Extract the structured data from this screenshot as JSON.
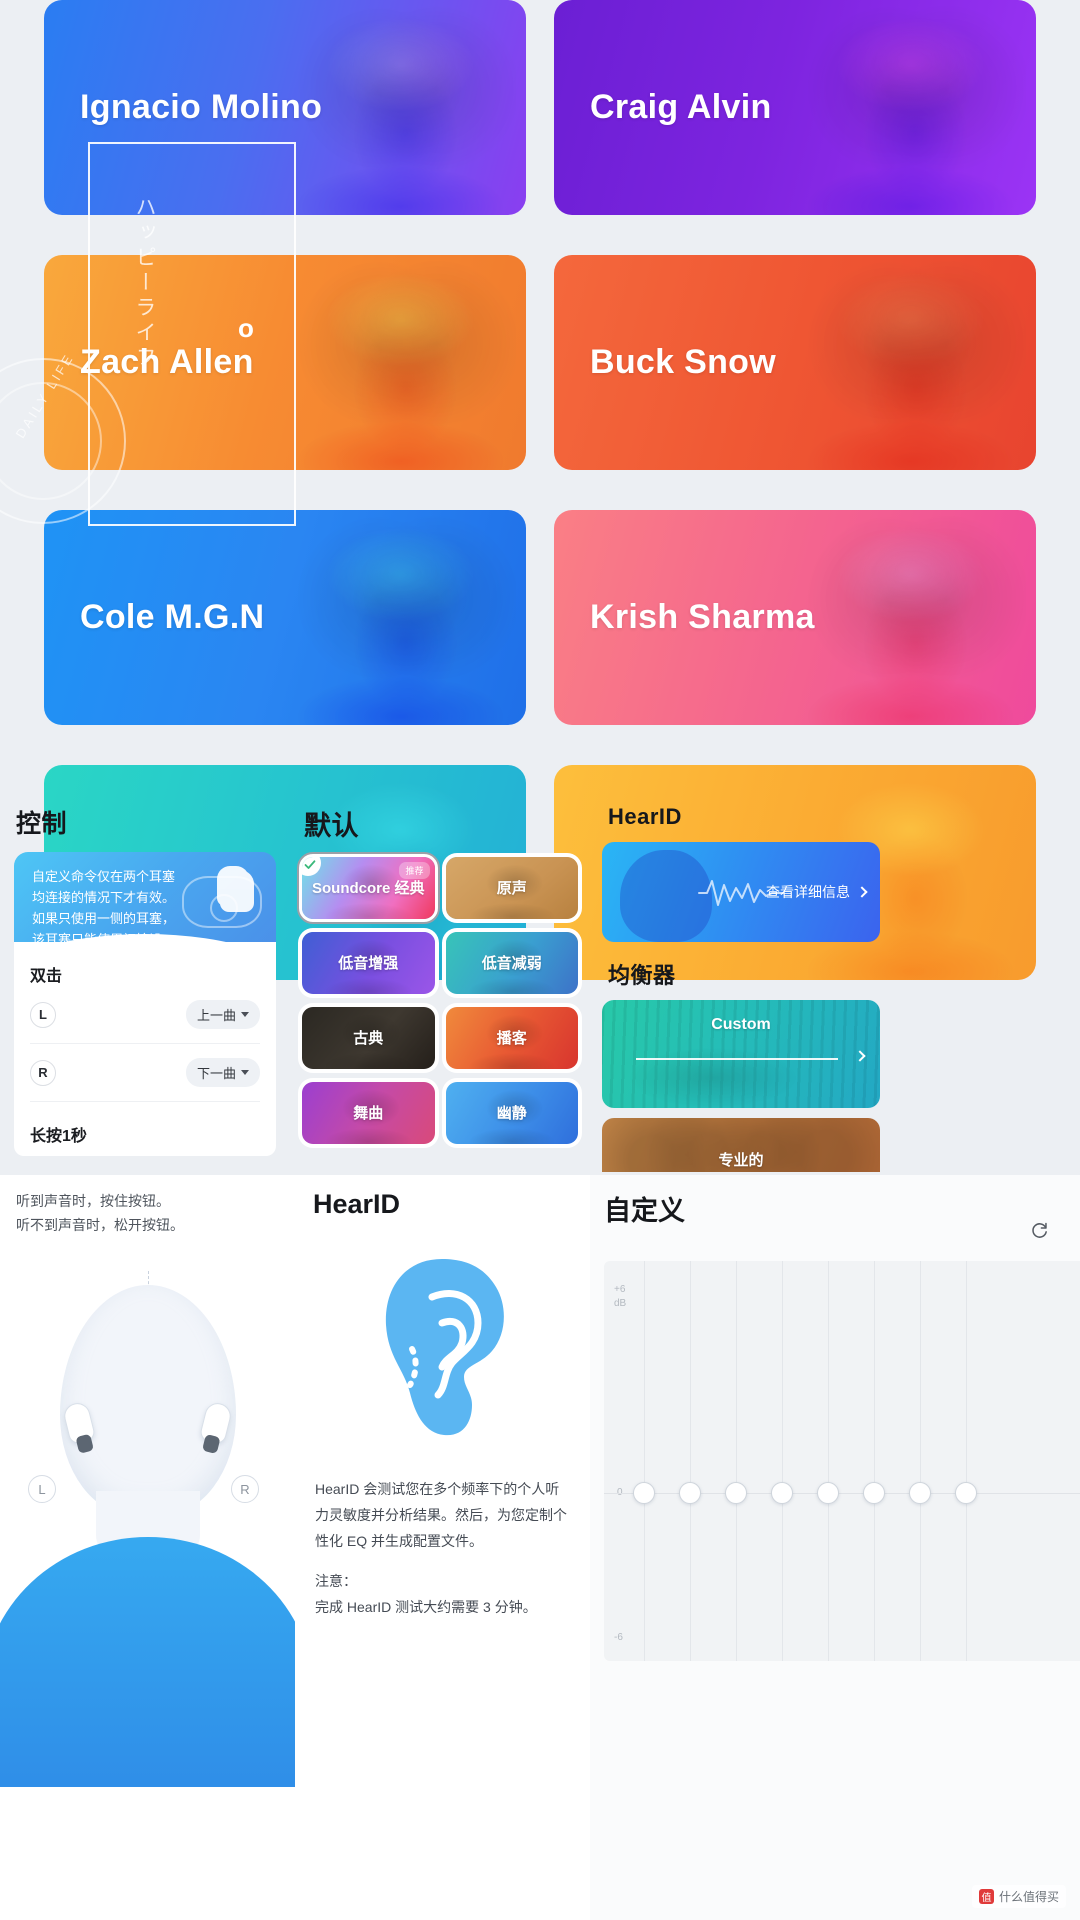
{
  "artists": {
    "rows": [
      [
        {
          "name": "Ignacio Molino",
          "theme": "c-ignacio"
        },
        {
          "name": "Craig Alvin",
          "theme": "c-craig"
        }
      ],
      [
        {
          "name": "Zach Allen",
          "theme": "c-zach"
        },
        {
          "name": "Buck Snow",
          "theme": "c-buck"
        }
      ],
      [
        {
          "name": "Cole M.G.N",
          "theme": "c-cole"
        },
        {
          "name": "Krish Sharma",
          "theme": "c-krish"
        }
      ],
      [
        {
          "name": "",
          "theme": "c-teal"
        },
        {
          "name": "",
          "theme": "c-amber"
        }
      ]
    ],
    "decor": {
      "japanese": "ハッピーライフ",
      "life_text": "DAILY LIFE",
      "degree_mark": "o"
    }
  },
  "control": {
    "title": "控制",
    "banner_text": "自定义命令仅在两个耳塞均连接的情况下才有效。如果只使用一侧的耳塞，该耳塞只能使用初始设置。",
    "double_tap_label": "双击",
    "long_press_label": "长按1秒",
    "rows": [
      {
        "side": "L",
        "action": "上一曲"
      },
      {
        "side": "R",
        "action": "下一曲"
      }
    ]
  },
  "eq_presets": {
    "title": "默认",
    "recommended_badge": "推荐",
    "items": [
      {
        "label": "Soundcore 经典",
        "theme": "g-classic",
        "selected": true,
        "badge": true
      },
      {
        "label": "原声",
        "theme": "g-acoustic",
        "selected": false,
        "badge": false
      },
      {
        "label": "低音增强",
        "theme": "g-bassup",
        "selected": false,
        "badge": false
      },
      {
        "label": "低音减弱",
        "theme": "g-bassdown",
        "selected": false,
        "badge": false
      },
      {
        "label": "古典",
        "theme": "g-classical",
        "selected": false,
        "badge": false
      },
      {
        "label": "播客",
        "theme": "g-podcast",
        "selected": false,
        "badge": false
      },
      {
        "label": "舞曲",
        "theme": "g-dance",
        "selected": false,
        "badge": false
      },
      {
        "label": "幽静",
        "theme": "g-quiet",
        "selected": false,
        "badge": false
      }
    ]
  },
  "hearid_section": {
    "title": "HearID",
    "detail_link": "查看详细信息",
    "equalizer_title": "均衡器",
    "custom_card_label": "Custom",
    "pro_card_label": "专业的"
  },
  "hearing_test": {
    "instruction_line1": "听到声音时，按住按钮。",
    "instruction_line2": "听不到声音时，松开按钮。",
    "left_marker": "L",
    "right_marker": "R"
  },
  "hearid_intro": {
    "title": "HearID",
    "description": "HearID 会测试您在多个频率下的个人听力灵敏度并分析结果。然后，为您定制个性化 EQ 并生成配置文件。",
    "note_title": "注意：",
    "note_text": "完成 HearID 测试大约需要 3 分钟。"
  },
  "custom_eq": {
    "title": "自定义",
    "reset_icon": "reset-icon",
    "axis_top": "+6",
    "axis_top_unit": "dB",
    "axis_mid": "0",
    "axis_bottom": "-6",
    "band_count": 8
  },
  "watermark": {
    "mark": "值",
    "text": "什么值得买"
  },
  "colors": {
    "page_bg": "#eceff3",
    "panel_bg": "#ffffff",
    "text_primary": "#16181c",
    "text_secondary": "#454b54",
    "accent_blue": "#2f8ef2",
    "accent_teal": "#25bdb8"
  }
}
